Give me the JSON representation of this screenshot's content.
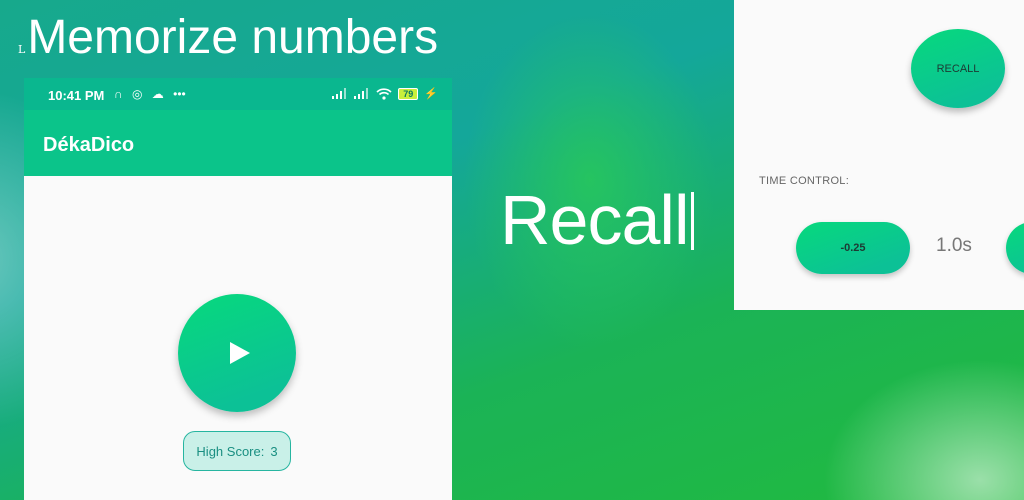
{
  "headline": {
    "mark": "L",
    "text": "Memorize numbers"
  },
  "feature_title": "Recall",
  "phone": {
    "status_bar": {
      "time": "10:41 PM",
      "left_icons": [
        "headphones-icon",
        "target-icon",
        "cloud-icon",
        "more-icon"
      ],
      "more": "•••",
      "battery": "79"
    },
    "app_title": "DékaDico",
    "play_button_icon": "play-icon",
    "high_score": {
      "label": "High Score:",
      "value": "3"
    }
  },
  "panel": {
    "recall_button": "RECALL",
    "time_control_label": "TIME CONTROL:",
    "decrease_button": "-0.25",
    "time_value": "1.0s"
  },
  "colors": {
    "accent": "#0bc48a",
    "status_bar": "#0ab78f",
    "badge_bg": "#c9f0e8",
    "badge_border": "#26b5a0"
  }
}
